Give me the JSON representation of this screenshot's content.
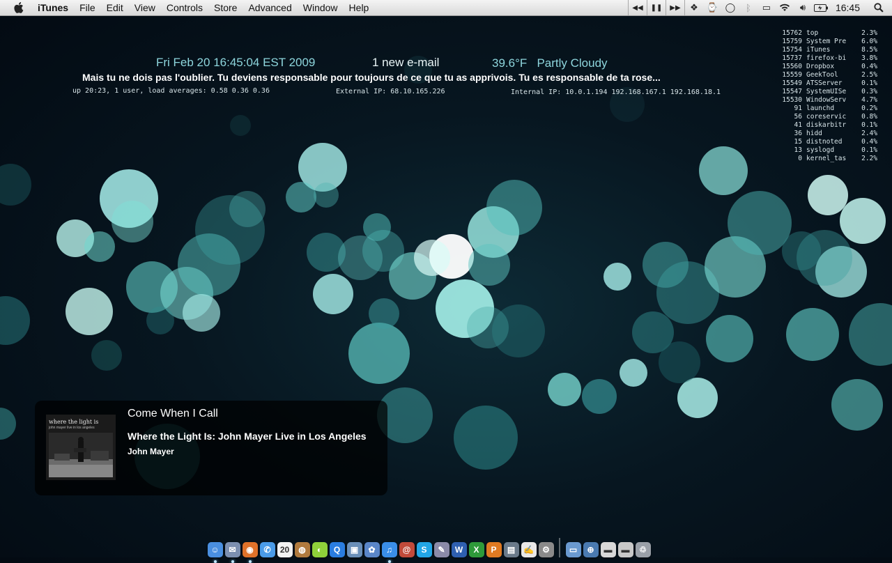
{
  "menubar": {
    "apple_icon": "apple-icon",
    "app_name": "iTunes",
    "items": [
      "File",
      "Edit",
      "View",
      "Controls",
      "Store",
      "Advanced",
      "Window",
      "Help"
    ],
    "transport_icons": [
      "previous-track-icon",
      "pause-icon",
      "next-track-icon"
    ],
    "status_icons": [
      "dropbox-icon",
      "timemachine-icon",
      "chat-status-icon",
      "bluetooth-icon",
      "display-icon",
      "wifi-icon",
      "volume-icon",
      "battery-icon"
    ],
    "clock": "16:45",
    "spotlight_icon": "spotlight-icon"
  },
  "geektool": {
    "datetime": "Fri Feb 20 16:45:04 EST 2009",
    "mail": "1 new e-mail",
    "temperature": "39.6°F",
    "weather": "Partly Cloudy",
    "quote": "Mais tu ne dois pas l'oublier. Tu deviens responsable pour toujours de ce que tu as apprivois. Tu es responsable de ta rose...",
    "uptime": "up 20:23, 1 user, load averages: 0.58 0.36 0.36",
    "external_ip": "External IP: 68.10.165.226",
    "internal_ip": "Internal IP: 10.0.1.194 192.168.167.1 192.168.18.1",
    "processes": [
      {
        "pid": "15762",
        "name": "top",
        "cpu": "2.3%"
      },
      {
        "pid": "15759",
        "name": "System Pre",
        "cpu": "6.0%"
      },
      {
        "pid": "15754",
        "name": "iTunes",
        "cpu": "8.5%"
      },
      {
        "pid": "15737",
        "name": "firefox-bi",
        "cpu": "3.8%"
      },
      {
        "pid": "15560",
        "name": "Dropbox",
        "cpu": "0.4%"
      },
      {
        "pid": "15559",
        "name": "GeekTool",
        "cpu": "2.5%"
      },
      {
        "pid": "15549",
        "name": "ATSServer",
        "cpu": "0.1%"
      },
      {
        "pid": "15547",
        "name": "SystemUISe",
        "cpu": "0.3%"
      },
      {
        "pid": "15530",
        "name": "WindowServ",
        "cpu": "4.7%"
      },
      {
        "pid": "91",
        "name": "launchd",
        "cpu": "0.2%"
      },
      {
        "pid": "56",
        "name": "coreservic",
        "cpu": "0.8%"
      },
      {
        "pid": "41",
        "name": "diskarbitr",
        "cpu": "0.1%"
      },
      {
        "pid": "36",
        "name": "hidd",
        "cpu": "2.4%"
      },
      {
        "pid": "15",
        "name": "distnoted",
        "cpu": "0.4%"
      },
      {
        "pid": "13",
        "name": "syslogd",
        "cpu": "0.1%"
      },
      {
        "pid": "0",
        "name": "kernel_tas",
        "cpu": "2.2%"
      }
    ]
  },
  "notification": {
    "track": "Come When I Call",
    "album": "Where the Light Is: John Mayer Live in Los Angeles",
    "artist": "John Mayer",
    "art_title": "where the light is",
    "art_subtitle": "john mayer live in los angeles"
  },
  "dock": {
    "apps": [
      {
        "name": "finder",
        "color": "#4a8fe0",
        "glyph": "☺",
        "running": true
      },
      {
        "name": "mail",
        "color": "#7c8fb0",
        "glyph": "✉",
        "running": true
      },
      {
        "name": "firefox",
        "color": "#e0722a",
        "glyph": "◉",
        "running": true
      },
      {
        "name": "ichat",
        "color": "#4a9be8",
        "glyph": "✆",
        "running": false
      },
      {
        "name": "ical",
        "color": "#f2f2f2",
        "glyph": "20",
        "running": false
      },
      {
        "name": "adium",
        "color": "#b07a3e",
        "glyph": "◍",
        "running": false
      },
      {
        "name": "limewire",
        "color": "#8fd13a",
        "glyph": "◐",
        "running": false
      },
      {
        "name": "quicktime",
        "color": "#2a7de0",
        "glyph": "Q",
        "running": false
      },
      {
        "name": "preview",
        "color": "#6a8fb8",
        "glyph": "▣",
        "running": false
      },
      {
        "name": "iphoto",
        "color": "#5a86c8",
        "glyph": "✿",
        "running": false
      },
      {
        "name": "itunes",
        "color": "#3a8ee8",
        "glyph": "♫",
        "running": true
      },
      {
        "name": "address-book",
        "color": "#c24a3a",
        "glyph": "@",
        "running": false
      },
      {
        "name": "skype",
        "color": "#22a6e6",
        "glyph": "S",
        "running": false
      },
      {
        "name": "script-editor",
        "color": "#8a8aa8",
        "glyph": "✎",
        "running": false
      },
      {
        "name": "word",
        "color": "#2e5fb0",
        "glyph": "W",
        "running": false
      },
      {
        "name": "excel",
        "color": "#2e9a3a",
        "glyph": "X",
        "running": false
      },
      {
        "name": "powerpoint",
        "color": "#e07a22",
        "glyph": "P",
        "running": false
      },
      {
        "name": "photo-browser",
        "color": "#6a7a8a",
        "glyph": "▤",
        "running": false
      },
      {
        "name": "textedit",
        "color": "#e8e8e8",
        "glyph": "✍",
        "running": false
      },
      {
        "name": "system-preferences",
        "color": "#8a8a8a",
        "glyph": "⚙",
        "running": false
      }
    ],
    "stacks": [
      {
        "name": "applications-folder",
        "color": "#6a9ad0",
        "glyph": "▭"
      },
      {
        "name": "network",
        "color": "#4a7ab0",
        "glyph": "⊕"
      },
      {
        "name": "documents",
        "color": "#d8d8d8",
        "glyph": "▬"
      },
      {
        "name": "downloads",
        "color": "#c8c8c8",
        "glyph": "▬"
      },
      {
        "name": "trash",
        "color": "#9aa0a8",
        "glyph": "♲"
      }
    ]
  }
}
